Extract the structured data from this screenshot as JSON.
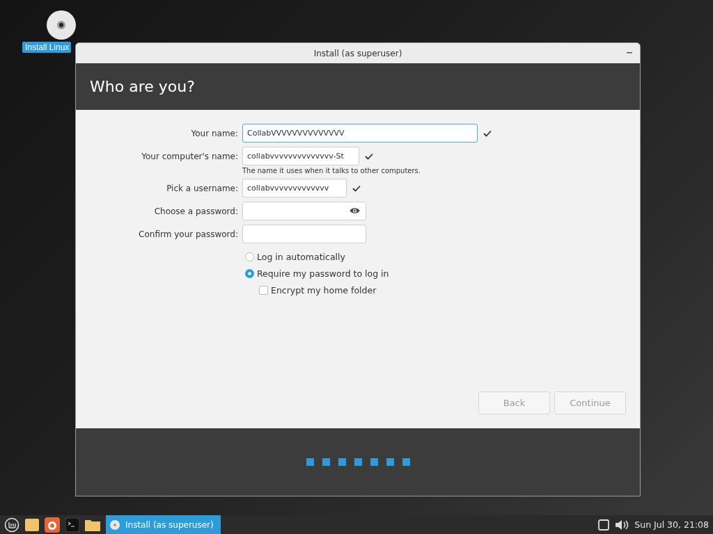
{
  "desktop_icons": [
    {
      "label": "Install Linux",
      "selected": true
    }
  ],
  "window": {
    "title": "Install (as superuser)",
    "heading": "Who are you?"
  },
  "form": {
    "fields": [
      {
        "kind": "text",
        "label": "Your name:",
        "value": "CollabVVVVVVVVVVVVVV",
        "focused": true,
        "valid": true
      },
      {
        "kind": "text",
        "label": "Your computer's name:",
        "value": "collabvvvvvvvvvvvvvv-St",
        "focused": false,
        "valid": true,
        "hint": "The name it uses when it talks to other computers."
      },
      {
        "kind": "text",
        "label": "Pick a username:",
        "value": "collabvvvvvvvvvvvvv",
        "focused": false,
        "valid": true
      },
      {
        "kind": "password",
        "label": "Choose a password:",
        "focused": false,
        "valid": false
      },
      {
        "kind": "text",
        "label": "Confirm your password:",
        "focused": false,
        "valid": false
      }
    ],
    "login_options": [
      {
        "label": "Log in automatically",
        "selected": false
      },
      {
        "label": "Require my password to log in",
        "selected": true
      }
    ],
    "encrypt": {
      "label": "Encrypt my home folder",
      "checked": false
    }
  },
  "buttons": [
    {
      "label": "Back",
      "disabled": true
    },
    {
      "label": "Continue",
      "disabled": true
    }
  ],
  "progress_steps": [
    {
      "done": true
    },
    {
      "done": true
    },
    {
      "done": true
    },
    {
      "done": true
    },
    {
      "done": true
    },
    {
      "done": true
    },
    {
      "done": true
    }
  ],
  "taskbar": {
    "window_button": {
      "label": "Install (as superuser)",
      "selected": true
    },
    "clock": "Sun Jul 30, 21:08"
  }
}
